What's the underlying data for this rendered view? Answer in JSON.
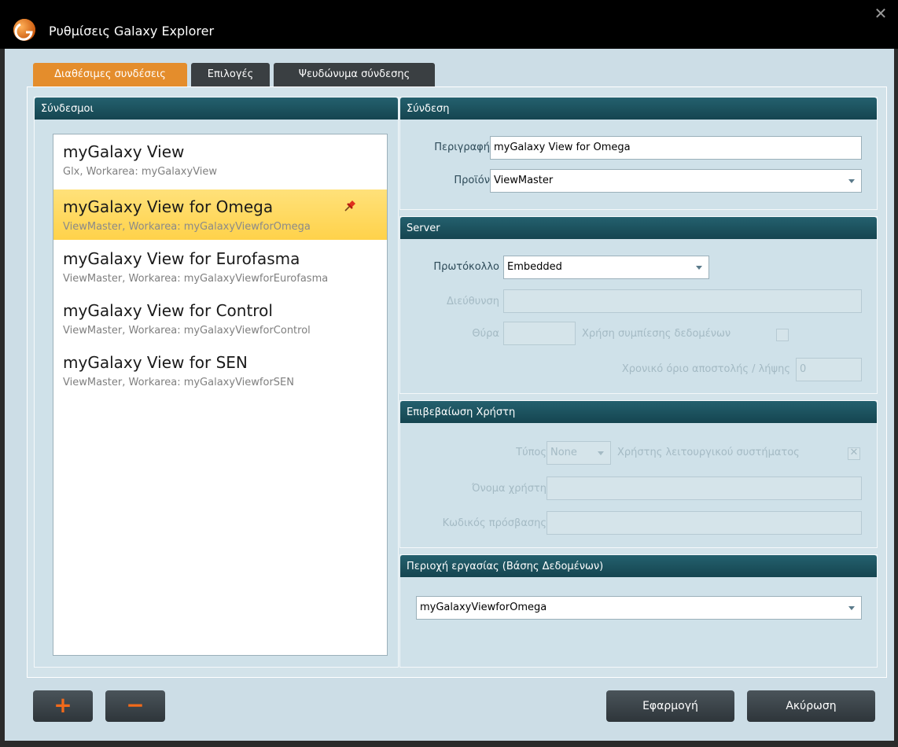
{
  "window": {
    "title": "Ρυθμίσεις Galaxy Explorer",
    "close_glyph": "✕",
    "app_icon": "galaxy-explorer-logo-icon"
  },
  "tabs": [
    {
      "label": "Διαθέσιμες συνδέσεις",
      "active": true
    },
    {
      "label": "Επιλογές",
      "active": false
    },
    {
      "label": "Ψευδώνυμα σύνδεσης",
      "active": false
    }
  ],
  "links_panel": {
    "header": "Σύνδεσμοι",
    "items": [
      {
        "title": "myGalaxy View",
        "subtitle": "Glx,  Workarea: myGalaxyView",
        "selected": false
      },
      {
        "title": "myGalaxy View for Omega",
        "subtitle": "ViewMaster,  Workarea: myGalaxyViewforOmega",
        "selected": true,
        "pinned": true
      },
      {
        "title": "myGalaxy View for Eurofasma",
        "subtitle": "ViewMaster,  Workarea: myGalaxyViewforEurofasma",
        "selected": false
      },
      {
        "title": "myGalaxy View for Control",
        "subtitle": "ViewMaster,  Workarea: myGalaxyViewforControl",
        "selected": false
      },
      {
        "title": "myGalaxy View for SEN",
        "subtitle": "ViewMaster,  Workarea: myGalaxyViewforSEN",
        "selected": false
      }
    ]
  },
  "connection": {
    "header": "Σύνδεση",
    "description_label": "Περιγραφή",
    "description_value": "myGalaxy View for Omega",
    "product_label": "Προϊόν",
    "product_value": "ViewMaster"
  },
  "server": {
    "header": "Server",
    "protocol_label": "Πρωτόκολλο",
    "protocol_value": "Embedded",
    "address_label": "Διεύθυνση",
    "address_value": "",
    "port_label": "Θύρα",
    "port_value": "",
    "compression_label": "Χρήση συμπίεσης δεδομένων",
    "compression_checked": false,
    "timeout_label": "Χρονικό όριο αποστολής / λήψης",
    "timeout_value": "0"
  },
  "user_auth": {
    "header": "Επιβεβαίωση Χρήστη",
    "type_label": "Τύπος",
    "type_value": "None",
    "os_user_label": "Χρήστης λειτουργικού συστήματος",
    "os_user_checked": true,
    "os_user_check_glyph": "✕",
    "username_label": "Όνομα χρήστη",
    "username_value": "",
    "password_label": "Κωδικός πρόσβασης",
    "password_value": ""
  },
  "workarea": {
    "header": "Περιοχή εργασίας (Βάσης Δεδομένων)",
    "value": "myGalaxyViewforOmega"
  },
  "buttons": {
    "add_glyph": "+",
    "remove_glyph": "−",
    "apply_label": "Εφαρμογή",
    "cancel_label": "Ακύρωση"
  },
  "colors": {
    "accent_orange": "#e48d2c",
    "header_teal": "#1d5663",
    "selected_yellow": "#ffd94f",
    "add_remove_glyph": "#f26a1a"
  }
}
